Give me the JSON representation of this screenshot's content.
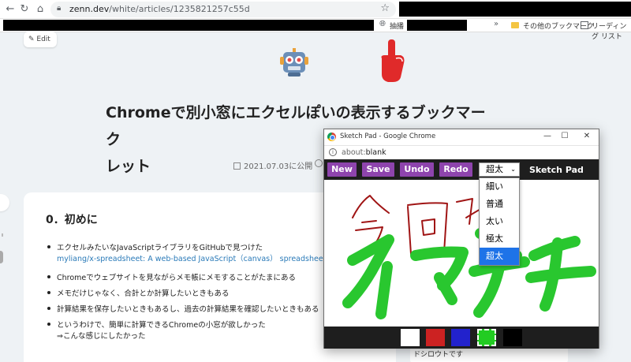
{
  "browser": {
    "url_host": "zenn.dev",
    "url_path": "/white/articles/1235821257c55d",
    "bookmarks": {
      "item1": "抽播",
      "other": "その他のブックマーク",
      "reading": "リーディング リスト"
    }
  },
  "page": {
    "edit_label": "Edit",
    "title_line1": "Chromeで別小窓にエクセルぽいの表示するブックマーク",
    "title_line2": "レット",
    "published": "2021.07.03に公開",
    "section_heading": "0．初めに",
    "bullets": [
      {
        "line1": "エクセルみたいなJavaScriptライブラリをGitHubで見つけた",
        "link": "myliang/x-spreadsheet: A web-based JavaScript（canvas） spreadsheet"
      },
      {
        "line1": "Chromeでウェブサイトを見ながらメモ帳にメモすることがたまにある"
      },
      {
        "line1": "メモだけじゃなく、合計とか計算したいときもある"
      },
      {
        "line1": "計算結果を保存したいときもあるし、過去の計算結果を確認したいときもある"
      },
      {
        "line1": "というわけで、簡単に計算できるChromeの小窓が欲しかった",
        "line2": "⇒こんな感じにしたかった"
      }
    ],
    "side_text": "ドシロウトです"
  },
  "popup": {
    "window_title": "Sketch Pad - Google Chrome",
    "url_scheme": "about:",
    "url_rest": "blank",
    "buttons": {
      "new": "New",
      "save": "Save",
      "undo": "Undo",
      "redo": "Redo"
    },
    "selected_size": "超太",
    "app_title": "Sketch Pad",
    "size_options": [
      "細い",
      "普通",
      "太い",
      "極太",
      "超太"
    ],
    "palette": [
      {
        "name": "white",
        "color": "#ffffff"
      },
      {
        "name": "red",
        "color": "#cc2222"
      },
      {
        "name": "blue",
        "color": "#2222cc"
      },
      {
        "name": "green",
        "color": "#22cc22",
        "active": true
      },
      {
        "name": "black",
        "color": "#000000"
      }
    ],
    "stroke_colors": {
      "red": "#a01515",
      "green": "#29c72f"
    }
  }
}
